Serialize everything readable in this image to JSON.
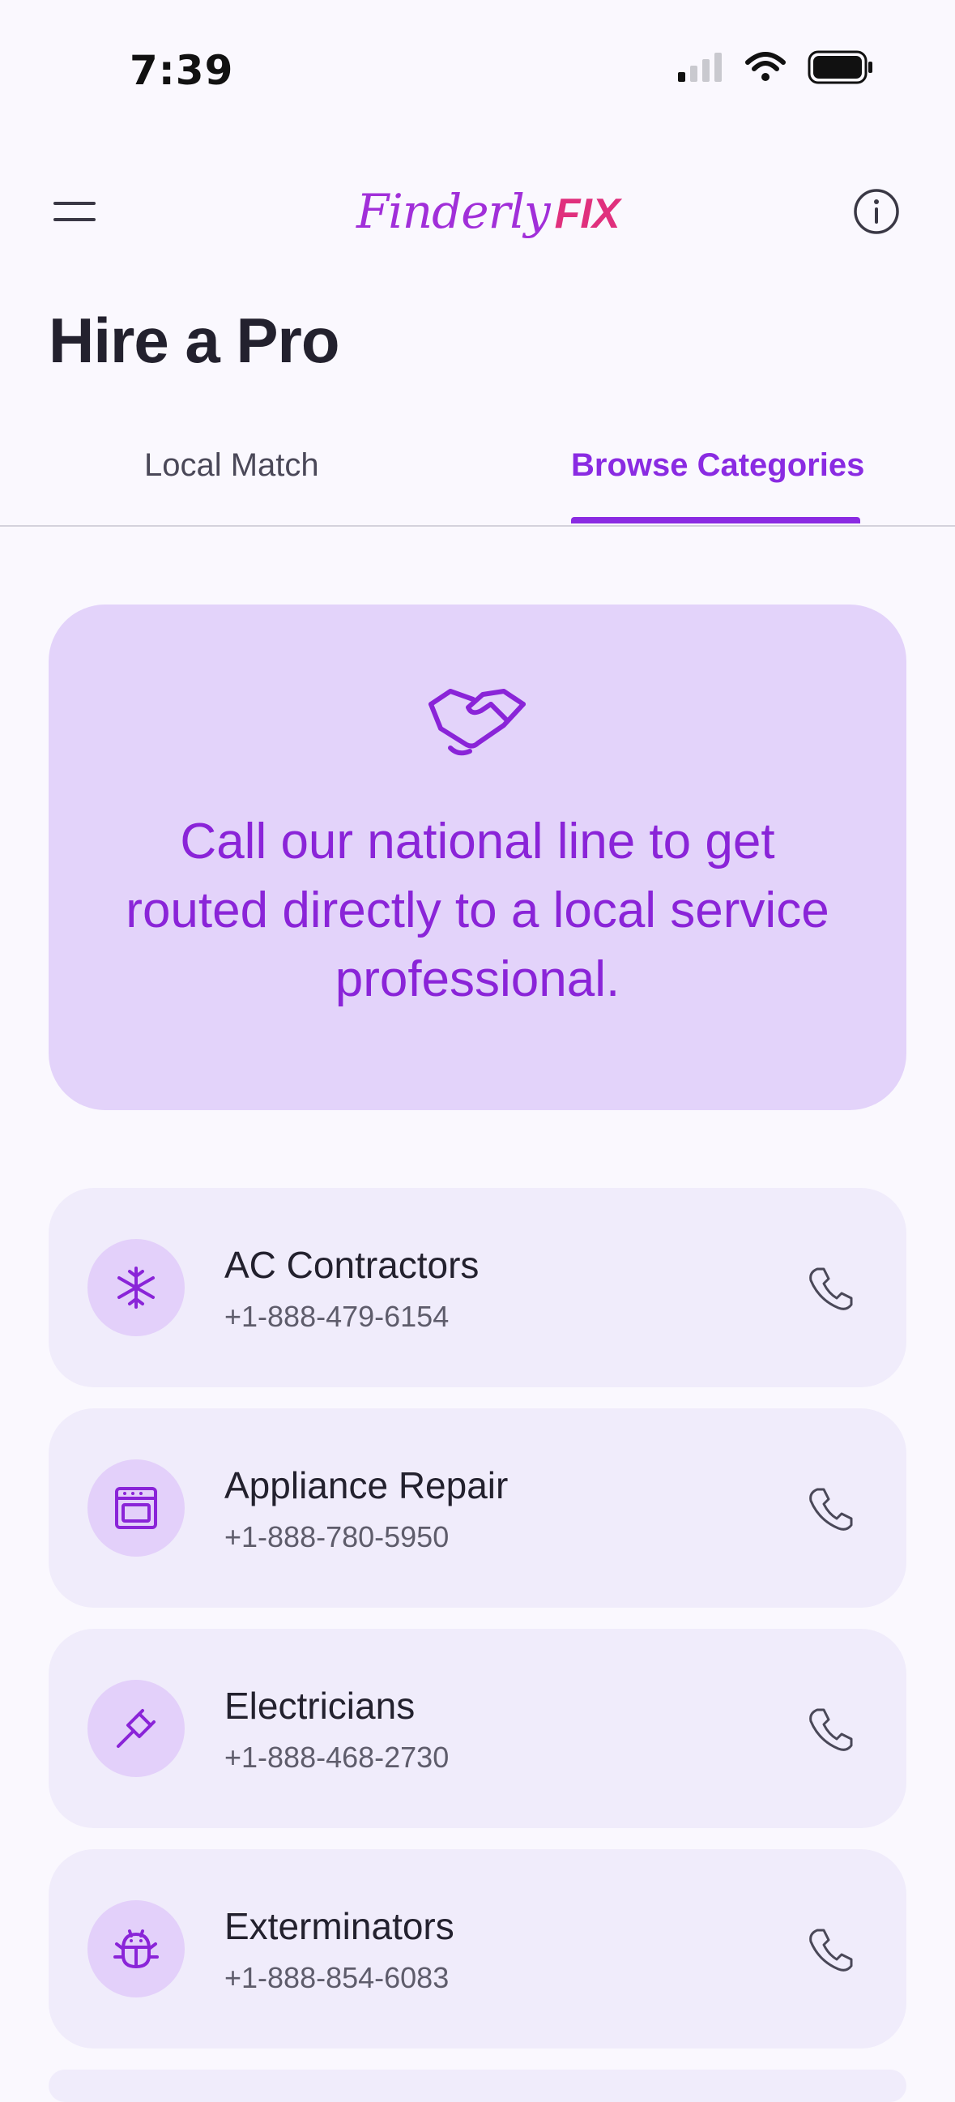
{
  "status_bar": {
    "time": "7:39"
  },
  "header": {
    "logo_script": "Finderly",
    "logo_bold": "FIX"
  },
  "page": {
    "title": "Hire a Pro"
  },
  "tabs": [
    {
      "label": "Local Match",
      "active": false
    },
    {
      "label": "Browse Categories",
      "active": true
    }
  ],
  "promo": {
    "icon": "handshake-icon",
    "text": "Call our national line to get routed directly to a local service professional."
  },
  "categories": [
    {
      "name": "AC Contractors",
      "phone": "+1-888-479-6154",
      "icon": "snowflake-icon"
    },
    {
      "name": "Appliance Repair",
      "phone": "+1-888-780-5950",
      "icon": "oven-icon"
    },
    {
      "name": "Electricians",
      "phone": "+1-888-468-2730",
      "icon": "plug-icon"
    },
    {
      "name": "Exterminators",
      "phone": "+1-888-854-6083",
      "icon": "bug-icon"
    }
  ],
  "colors": {
    "accent": "#8a2be2",
    "logo_script": "#a12fd9",
    "logo_bold": "#e0307d",
    "promo_bg": "#e3d3fa",
    "card_bg": "#f0ecfb",
    "background": "#faf8fe"
  }
}
